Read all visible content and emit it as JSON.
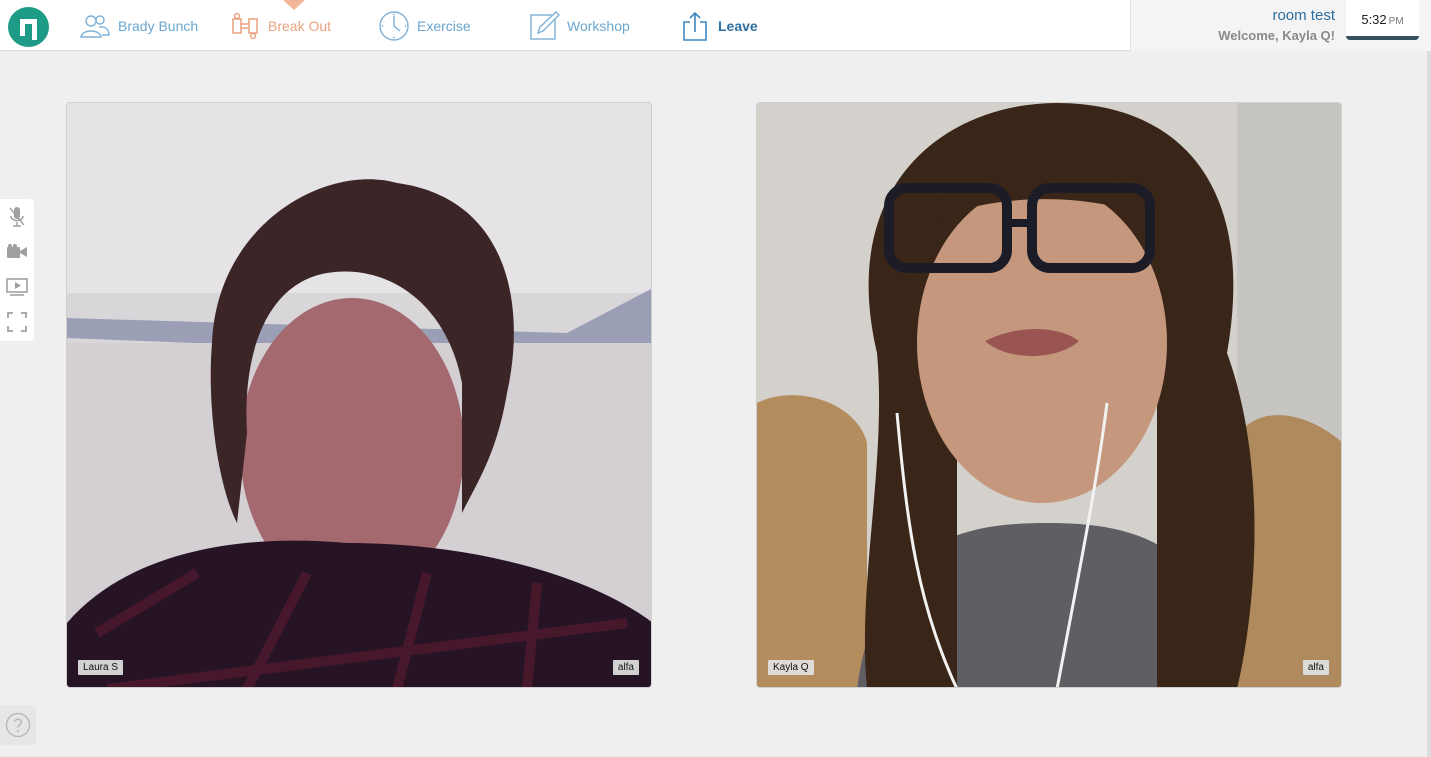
{
  "app": {
    "logo_icon": "logo-icon",
    "brand_color": "#1e9b86"
  },
  "nav": {
    "items": [
      {
        "label": "Brady Bunch",
        "icon": "group-icon",
        "active": false
      },
      {
        "label": "Break Out",
        "icon": "breakout-icon",
        "active": true
      },
      {
        "label": "Exercise",
        "icon": "clock-icon",
        "active": false
      },
      {
        "label": "Workshop",
        "icon": "pencil-icon",
        "active": false
      },
      {
        "label": "Leave",
        "icon": "share-exit-icon",
        "active": false
      }
    ],
    "colors": {
      "default": "#6aa6cf",
      "active": "#eaa07e",
      "leave": "#2d6ea0"
    }
  },
  "user": {
    "room_name": "room test",
    "welcome": "Welcome, Kayla Q!"
  },
  "clock": {
    "time": "5:32",
    "ampm": "PM"
  },
  "side_tools": [
    "microphone-icon",
    "camera-icon",
    "screen-share-icon",
    "fullscreen-icon"
  ],
  "tiles": [
    {
      "name": "Laura S",
      "room": "alfa"
    },
    {
      "name": "Kayla Q",
      "room": "alfa"
    }
  ],
  "help": {
    "icon": "help-icon"
  }
}
